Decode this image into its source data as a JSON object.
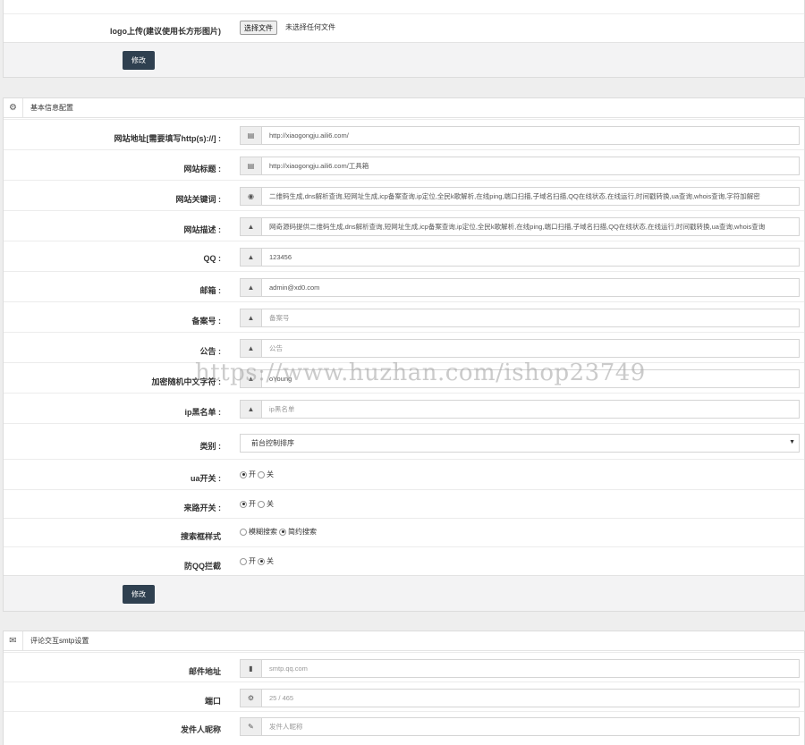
{
  "logo_section": {
    "label": "logo上传(建议使用长方形图片)",
    "file_button": "选择文件",
    "file_status": "未选择任何文件",
    "submit": "修改"
  },
  "basic": {
    "title": "基本信息配置",
    "icon": "gear-icon",
    "fields": [
      {
        "label": "网站地址[需要填写http(s)://] :",
        "value": "http://xiaogongju.aili6.com/",
        "icon": "id-card-icon",
        "placeholder": false
      },
      {
        "label": "网站标题 :",
        "value": "http://xiaogongju.aili6.com/工具箱",
        "icon": "id-card-icon",
        "placeholder": false
      },
      {
        "label": "网站关键词 :",
        "value": "二维码生成,dns解析查询,短网址生成,icp备案查询,ip定位,全民k歌解析,在线ping,端口扫描,子域名扫描,QQ在线状态,在线运行,时间戳转换,ua查询,whois查询,字符加解密",
        "icon": "eye-icon",
        "placeholder": false
      },
      {
        "label": "网站描述 :",
        "value": "网奇源码提供二维码生成,dns解析查询,短网址生成,icp备案查询,ip定位,全民k歌解析,在线ping,端口扫描,子域名扫描,QQ在线状态,在线运行,时间戳转换,ua查询,whois查询",
        "icon": "picture-icon",
        "placeholder": false
      },
      {
        "label": "QQ :",
        "value": "123456",
        "icon": "picture-icon",
        "placeholder": false
      },
      {
        "label": "邮箱 :",
        "value": "admin@xd0.com",
        "icon": "picture-icon",
        "placeholder": false
      },
      {
        "label": "备案号 :",
        "value": "备案号",
        "icon": "picture-icon",
        "placeholder": true
      },
      {
        "label": "公告 :",
        "value": "公告",
        "icon": "picture-icon",
        "placeholder": true
      },
      {
        "label": "加密随机中文字符 :",
        "value": "oYoung",
        "icon": "picture-icon",
        "placeholder": false
      },
      {
        "label": "ip黑名单 :",
        "value": "ip黑名单",
        "icon": "picture-icon",
        "placeholder": true
      }
    ],
    "category": {
      "label": "类别 :",
      "selected": "前台控制排序"
    },
    "ua_switch": {
      "label": "ua开关 :",
      "options": [
        "开",
        "关"
      ],
      "checked": 0
    },
    "referer_switch": {
      "label": "来路开关 :",
      "options": [
        "开",
        "关"
      ],
      "checked": 0
    },
    "search_style": {
      "label": "搜索框样式",
      "options": [
        "模糊搜索",
        "简约搜索"
      ],
      "checked": 1
    },
    "qq_block": {
      "label": "防QQ拦截",
      "options": [
        "开",
        "关"
      ],
      "checked": 1
    },
    "submit": "修改"
  },
  "smtp": {
    "title": "评论交互smtp设置",
    "icon": "envelope-icon",
    "fields": [
      {
        "label": "邮件地址",
        "value": "smtp.qq.com",
        "icon": "bookmark-icon"
      },
      {
        "label": "端口",
        "value": "25 / 465",
        "icon": "cogs-icon"
      },
      {
        "label": "发件人昵称",
        "value": "发件人昵称",
        "icon": "edit-icon"
      }
    ]
  },
  "watermark": "https://www.huzhan.com/ishop23749"
}
